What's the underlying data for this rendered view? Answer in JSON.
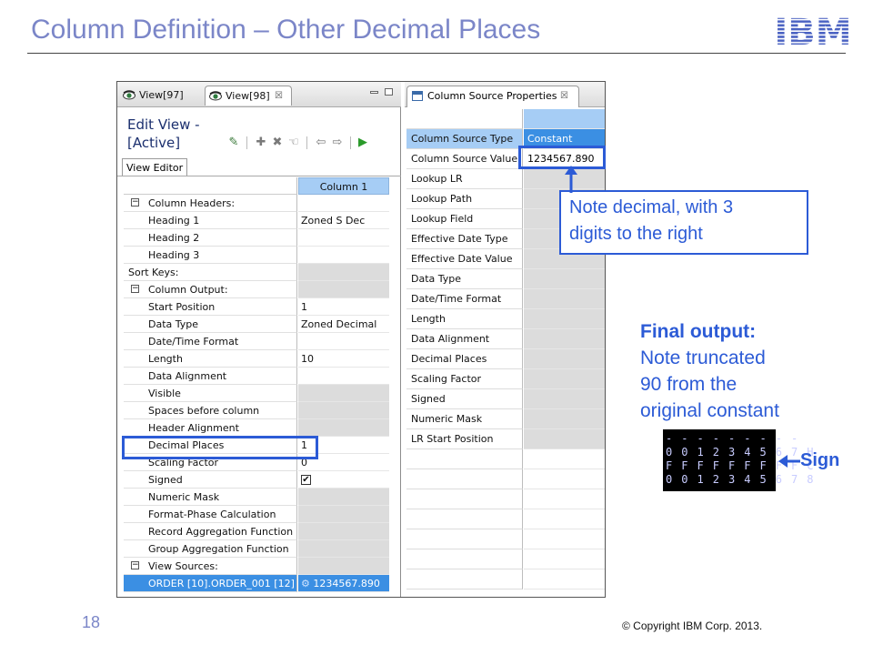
{
  "slide": {
    "title": "Column Definition – Other Decimal Places",
    "logo": "IBM",
    "page_number": "18",
    "copyright": "© Copyright  IBM Corp. 2013."
  },
  "left_pane": {
    "tabs": [
      {
        "label": "View[97]",
        "icon": "eye-icon",
        "active": false
      },
      {
        "label": "View[98]",
        "icon": "eye-icon",
        "active": true,
        "close": "☒"
      }
    ],
    "edit_title_line1": "Edit View -",
    "edit_title_line2": "[Active]",
    "toolbar_icons": [
      "edit-icon",
      "add-icon",
      "delete-icon",
      "pointer-icon",
      "back-icon",
      "forward-icon",
      "run-icon"
    ],
    "view_editor_tab": "View Editor",
    "grid_header": "Column 1",
    "rows": [
      {
        "label": "Column Headers:",
        "value": "",
        "expander": true,
        "indent": 1
      },
      {
        "label": "Heading 1",
        "value": "Zoned S Dec",
        "indent": 2
      },
      {
        "label": "Heading 2",
        "value": "",
        "indent": 2
      },
      {
        "label": "Heading 3",
        "value": "",
        "indent": 2
      },
      {
        "label": "Sort Keys:",
        "value": "",
        "indent": 0,
        "shaded": true
      },
      {
        "label": "Column Output:",
        "value": "",
        "expander": true,
        "indent": 1,
        "shaded": true
      },
      {
        "label": "Start Position",
        "value": "1",
        "indent": 2
      },
      {
        "label": "Data Type",
        "value": "Zoned Decimal",
        "indent": 2
      },
      {
        "label": "Date/Time Format",
        "value": "",
        "indent": 2
      },
      {
        "label": "Length",
        "value": "10",
        "indent": 2
      },
      {
        "label": "Data Alignment",
        "value": "",
        "indent": 2
      },
      {
        "label": "Visible",
        "value": "",
        "indent": 2,
        "shaded": true
      },
      {
        "label": "Spaces before column",
        "value": "",
        "indent": 2,
        "shaded": true
      },
      {
        "label": "Header Alignment",
        "value": "",
        "indent": 2,
        "shaded": true
      },
      {
        "label": "Decimal Places",
        "value": "1",
        "indent": 2
      },
      {
        "label": "Scaling Factor",
        "value": "0",
        "indent": 2
      },
      {
        "label": "Signed",
        "value": "✔",
        "indent": 2,
        "checkbox": true
      },
      {
        "label": "Numeric Mask",
        "value": "",
        "indent": 2,
        "shaded": true
      },
      {
        "label": "Format-Phase Calculation",
        "value": "",
        "indent": 2,
        "shaded": true
      },
      {
        "label": "Record Aggregation Function",
        "value": "",
        "indent": 2,
        "shaded": true
      },
      {
        "label": "Group Aggregation Function",
        "value": "",
        "indent": 2,
        "shaded": true
      },
      {
        "label": "View Sources:",
        "value": "",
        "expander": true,
        "indent": 1,
        "shaded": true
      },
      {
        "label": "ORDER [10].ORDER_001 [12]",
        "value": "1234567.890",
        "indent": 2,
        "selected": true
      }
    ]
  },
  "right_pane": {
    "tab_label": "Column Source Properties",
    "tab_close": "☒",
    "rows": [
      {
        "label": "",
        "value": "",
        "type": "header"
      },
      {
        "label": "Column Source Type",
        "value": "Constant",
        "type": "selected"
      },
      {
        "label": "Column Source Value",
        "value": "1234567.890",
        "type": "white"
      },
      {
        "label": "Lookup LR",
        "value": ""
      },
      {
        "label": "Lookup Path",
        "value": ""
      },
      {
        "label": "Lookup Field",
        "value": ""
      },
      {
        "label": "Effective Date Type",
        "value": ""
      },
      {
        "label": "Effective Date Value",
        "value": ""
      },
      {
        "label": "Data Type",
        "value": ""
      },
      {
        "label": "Date/Time Format",
        "value": ""
      },
      {
        "label": "Length",
        "value": ""
      },
      {
        "label": "Data Alignment",
        "value": ""
      },
      {
        "label": "Decimal Places",
        "value": ""
      },
      {
        "label": "Scaling Factor",
        "value": ""
      },
      {
        "label": "Signed",
        "value": ""
      },
      {
        "label": "Numeric Mask",
        "value": ""
      },
      {
        "label": "LR Start Position",
        "value": ""
      },
      {
        "label": "",
        "value": "",
        "type": "empty"
      },
      {
        "label": "",
        "value": "",
        "type": "empty"
      },
      {
        "label": "",
        "value": "",
        "type": "empty"
      },
      {
        "label": "",
        "value": "",
        "type": "empty"
      },
      {
        "label": "",
        "value": "",
        "type": "empty"
      },
      {
        "label": "",
        "value": "",
        "type": "empty"
      },
      {
        "label": "",
        "value": "",
        "type": "empty"
      }
    ]
  },
  "callouts": {
    "note_line1": "Note decimal, with 3",
    "note_line2": "digits to the right",
    "final_heading": "Final output:",
    "final_line1": "Note truncated",
    "final_line2": "90 from the",
    "final_line3": "original constant",
    "sign_label": "Sign"
  },
  "hex_dump": {
    "lines": [
      " - - - - - - - - -",
      "0 0 1 2 3 4 5 6 7 H",
      "F F F F F F F F F C",
      "0 0 1 2 3 4 5 6 7 8",
      " - - - - - - - - -"
    ]
  },
  "colors": {
    "title": "#7b86c8",
    "callout": "#2c5bd6",
    "selection": "#3b8fe3",
    "header_blue": "#a6cdf5"
  }
}
